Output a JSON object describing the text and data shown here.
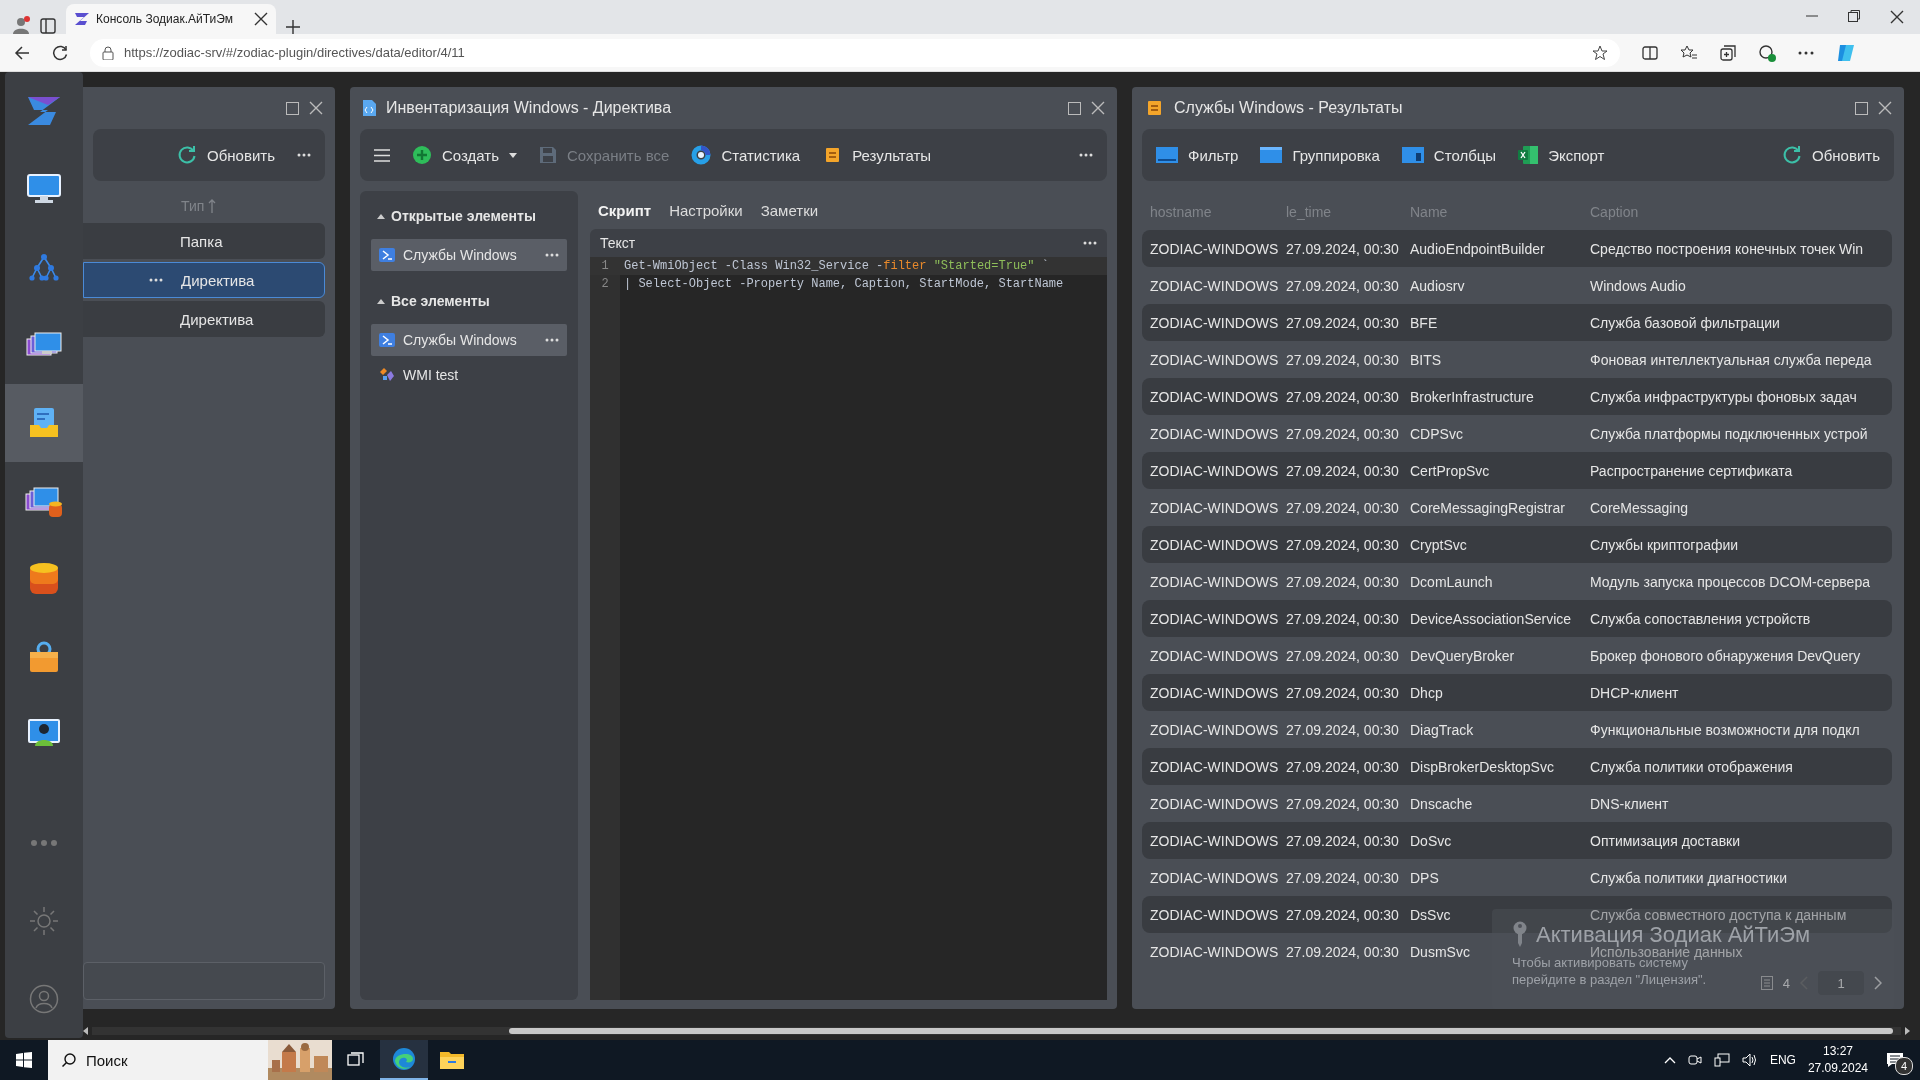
{
  "browser": {
    "tab": {
      "title": "Консоль Зодиак.АйТиЭм",
      "selected": true
    },
    "url": "https://zodiac-srv/#/zodiac-plugin/directives/data/editor/4/11"
  },
  "sidebar": {
    "items": [
      {
        "selected": false
      },
      {
        "selected": false
      },
      {
        "selected": false
      },
      {
        "selected": true
      },
      {
        "selected": false
      },
      {
        "selected": false
      },
      {
        "selected": false
      },
      {
        "selected": false
      }
    ]
  },
  "left_panel": {
    "refresh": "Обновить",
    "column": "Тип",
    "rows": [
      {
        "label": "Папка",
        "selected": false
      },
      {
        "label": "Директива",
        "selected": true
      },
      {
        "label": "Директива",
        "selected": false
      }
    ]
  },
  "directive_panel": {
    "title": "Инвентаризация Windows - Директива",
    "toolbar": [
      {
        "label": "Создать",
        "kind": "create",
        "disabled": false
      },
      {
        "label": "Сохранить все",
        "kind": "save",
        "disabled": true
      },
      {
        "label": "Статистика",
        "kind": "stats",
        "disabled": false
      },
      {
        "label": "Результаты",
        "kind": "results",
        "disabled": false
      }
    ],
    "sections": [
      {
        "title": "Открытые элементы",
        "expanded": true,
        "items": [
          {
            "label": "Службы Windows",
            "kind": "script",
            "selected": true
          }
        ]
      },
      {
        "title": "Все элементы",
        "expanded": true,
        "items": [
          {
            "label": "Службы Windows",
            "kind": "script",
            "selected": true
          },
          {
            "label": "WMI test",
            "kind": "wmi",
            "selected": false
          }
        ]
      }
    ],
    "tabs": [
      {
        "label": "Скрипт",
        "selected": true
      },
      {
        "label": "Настройки",
        "selected": false
      },
      {
        "label": "Заметки",
        "selected": false
      }
    ],
    "editor": {
      "title": "Текст",
      "lines": [
        {
          "number": "1",
          "tokens": [
            {
              "text": "Get-WmiObject -Class Win32_Service -",
              "kind": "plain"
            },
            {
              "text": "filter",
              "kind": "keyword"
            },
            {
              "text": " \"Started=True\"",
              "kind": "string"
            },
            {
              "text": " `",
              "kind": "plain"
            }
          ]
        },
        {
          "number": "2",
          "tokens": [
            {
              "text": "| Select-Object -Property Name, Caption, StartMode, StartName",
              "kind": "plain"
            }
          ]
        }
      ]
    }
  },
  "results_panel": {
    "title": "Службы Windows - Результаты",
    "toolbar": [
      {
        "label": "Фильтр",
        "kind": "filter"
      },
      {
        "label": "Группировка",
        "kind": "group"
      },
      {
        "label": "Столбцы",
        "kind": "columns"
      },
      {
        "label": "Экспорт",
        "kind": "export"
      }
    ],
    "refresh": "Обновить",
    "table": {
      "columns": [
        "hostname",
        "le_time",
        "Name",
        "Caption"
      ],
      "rows": [
        [
          "ZODIAC-WINDOWS",
          "27.09.2024, 00:30",
          "AudioEndpointBuilder",
          "Средство построения конечных точек Win"
        ],
        [
          "ZODIAC-WINDOWS",
          "27.09.2024, 00:30",
          "Audiosrv",
          "Windows Audio"
        ],
        [
          "ZODIAC-WINDOWS",
          "27.09.2024, 00:30",
          "BFE",
          "Служба базовой фильтрации"
        ],
        [
          "ZODIAC-WINDOWS",
          "27.09.2024, 00:30",
          "BITS",
          "Фоновая интеллектуальная служба переда"
        ],
        [
          "ZODIAC-WINDOWS",
          "27.09.2024, 00:30",
          "BrokerInfrastructure",
          "Служба инфраструктуры фоновых задач"
        ],
        [
          "ZODIAC-WINDOWS",
          "27.09.2024, 00:30",
          "CDPSvc",
          "Служба платформы подключенных устрой"
        ],
        [
          "ZODIAC-WINDOWS",
          "27.09.2024, 00:30",
          "CertPropSvc",
          "Распространение сертификата"
        ],
        [
          "ZODIAC-WINDOWS",
          "27.09.2024, 00:30",
          "CoreMessagingRegistrar",
          "CoreMessaging"
        ],
        [
          "ZODIAC-WINDOWS",
          "27.09.2024, 00:30",
          "CryptSvc",
          "Службы криптографии"
        ],
        [
          "ZODIAC-WINDOWS",
          "27.09.2024, 00:30",
          "DcomLaunch",
          "Модуль запуска процессов DCOM-сервера"
        ],
        [
          "ZODIAC-WINDOWS",
          "27.09.2024, 00:30",
          "DeviceAssociationService",
          "Служба сопоставления устройств"
        ],
        [
          "ZODIAC-WINDOWS",
          "27.09.2024, 00:30",
          "DevQueryBroker",
          "Брокер фонового обнаружения DevQuery"
        ],
        [
          "ZODIAC-WINDOWS",
          "27.09.2024, 00:30",
          "Dhcp",
          "DHCP-клиент"
        ],
        [
          "ZODIAC-WINDOWS",
          "27.09.2024, 00:30",
          "DiagTrack",
          "Функциональные возможности для подкл"
        ],
        [
          "ZODIAC-WINDOWS",
          "27.09.2024, 00:30",
          "DispBrokerDesktopSvc",
          "Служба политики отображения"
        ],
        [
          "ZODIAC-WINDOWS",
          "27.09.2024, 00:30",
          "Dnscache",
          "DNS-клиент"
        ],
        [
          "ZODIAC-WINDOWS",
          "27.09.2024, 00:30",
          "DoSvc",
          "Оптимизация доставки"
        ],
        [
          "ZODIAC-WINDOWS",
          "27.09.2024, 00:30",
          "DPS",
          "Служба политики диагностики"
        ],
        [
          "ZODIAC-WINDOWS",
          "27.09.2024, 00:30",
          "DsSvc",
          "Служба совместного доступа к данным"
        ],
        [
          "ZODIAC-WINDOWS",
          "27.09.2024, 00:30",
          "DusmSvc",
          "Использование данных"
        ]
      ]
    },
    "pagination": {
      "count": "4",
      "page": "1",
      "prev": {
        "disabled": true
      },
      "next": {
        "disabled": false
      }
    }
  },
  "activation": {
    "title": "Активация Зодиак АйТиЭм",
    "message": "Чтобы активировать систему перейдите в раздел \"Лицензия\"."
  },
  "taskbar": {
    "search": {
      "placeholder": "Поиск"
    },
    "language": "ENG",
    "time": "13:27",
    "date": "27.09.2024",
    "notifications": "4"
  }
}
